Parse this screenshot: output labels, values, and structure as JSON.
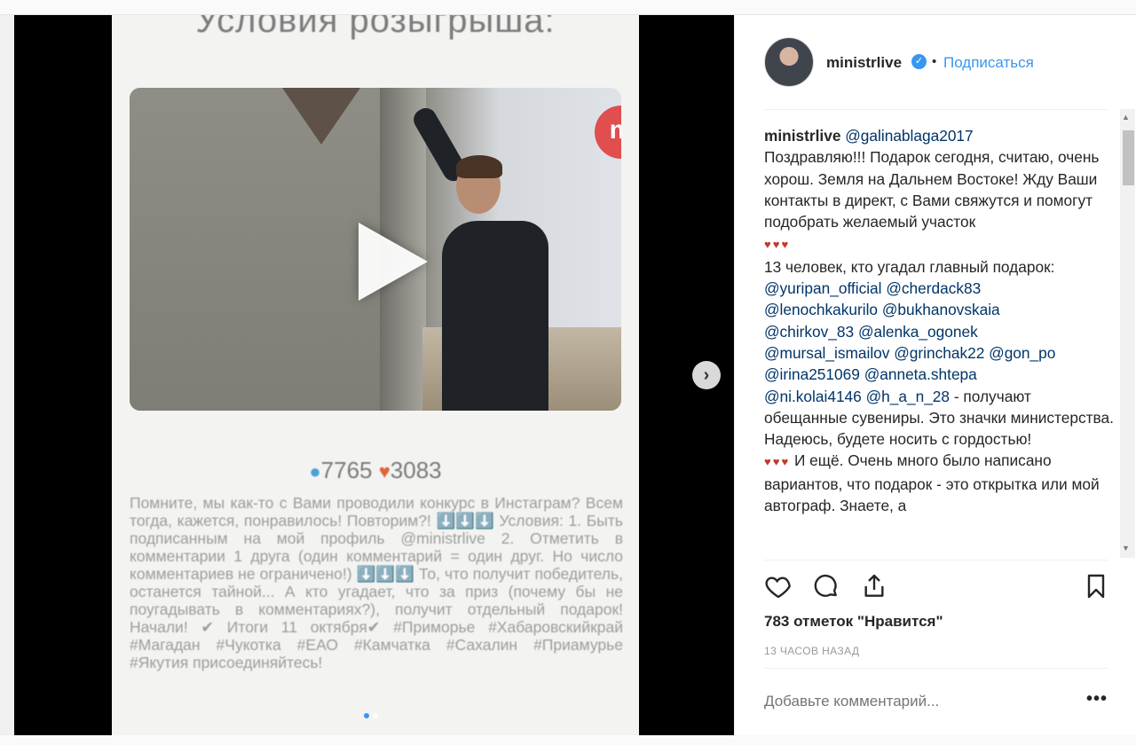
{
  "media": {
    "phone_title": "Условия розыгрыша:",
    "badge": "m",
    "stats": {
      "comments": "7765",
      "likes": "3083"
    },
    "phone_text": "Помните, мы как-то с Вами проводили конкурс в Инстаграм? Всем тогда, кажется, понравилось! Повторим?! ⬇️⬇️⬇️ Условия: 1. Быть подписанным на мой профиль @ministrlive 2. Отметить в комментарии 1 друга (один комментарий = один друг. Но число комментариев не ограничено!) ⬇️⬇️⬇️ То, что получит победитель, останется тайной... А кто угадает, что за приз (почему бы не поугадывать в комментариях?), получит отдельный подарок! Начали! ✔ Итоги 11 октября✔ #Приморье #Хабаровскийкрай #Магадан #Чукотка #ЕАО #Камчатка #Сахалин #Приамурье #Якутия присоединяйтесь!",
    "next_icon": "chevron-right-icon"
  },
  "header": {
    "username": "ministrlive",
    "separator": "•",
    "follow_label": "Подписаться",
    "verified_icon": "verified-badge-icon"
  },
  "comment": {
    "author": "ministrlive",
    "mention1": "@galinablaga2017",
    "text1": "Поздравляю!!! Подарок сегодня, считаю, очень хорош. Земля на Дальнем Востоке! Жду Ваши контакты в директ, с Вами свяжутся и помогут подобрать желаемый участок",
    "hearts": "♥♥♥",
    "text2": "13 человек, кто угадал главный подарок:",
    "mentions": [
      "@yuripan_official",
      "@cherdack83",
      "@lenochkakurilo",
      "@bukhanovskaia",
      "@chirkov_83",
      "@alenka_ogonek",
      "@mursal_ismailov",
      "@grinchak22",
      "@gon_po",
      "@irina251069",
      "@anneta.shtepa",
      "@ni.kolai4146",
      "@h_a_n_28"
    ],
    "text3": " - получают обещанные сувениры. Это значки министерства. Надеюсь, будете носить с гордостью!",
    "text4": " И ещё. Очень много было написано вариантов, что подарок - это открытка или мой автограф. Знаете, а"
  },
  "actions": {
    "like_icon": "heart-icon",
    "comment_icon": "comment-icon",
    "share_icon": "share-icon",
    "save_icon": "bookmark-icon"
  },
  "likes_text": "783 отметок \"Нравится\"",
  "timestamp": "13 ЧАСОВ НАЗАД",
  "add_comment_placeholder": "Добавьте комментарий...",
  "more_label": "•••",
  "colors": {
    "accent": "#3897f0",
    "mention": "#003569",
    "text": "#262626",
    "muted": "#999999"
  }
}
